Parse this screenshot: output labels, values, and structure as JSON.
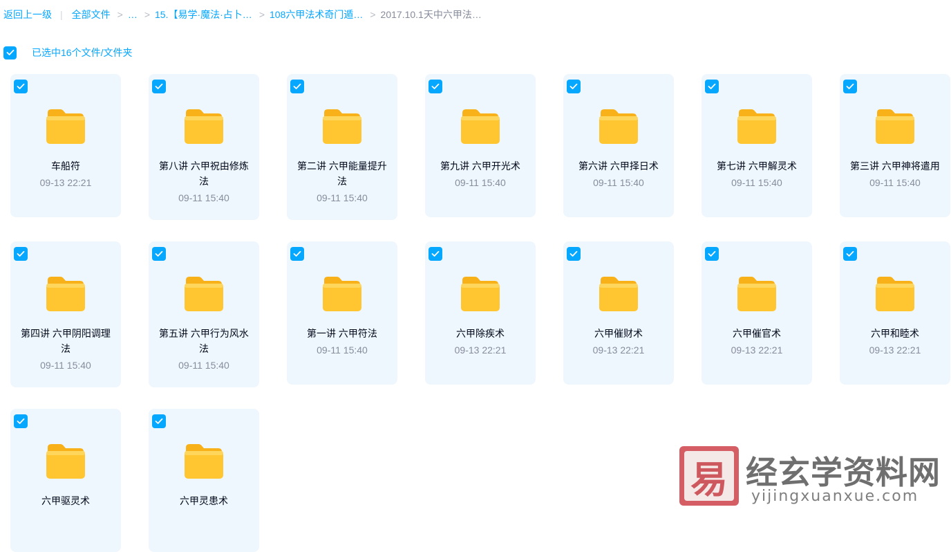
{
  "breadcrumb": {
    "back": "返回上一级",
    "all_files": "全部文件",
    "ellipsis": "…",
    "level1": "15.【易学·魔法·占卜…",
    "level2": "108六甲法术奇门遁…",
    "current": "2017.10.1天中六甲法…"
  },
  "selection": {
    "text": "已选中16个文件/文件夹",
    "checked": true
  },
  "colors": {
    "accent": "#06a7ff",
    "card_bg": "#eef7fe",
    "folder_yellow": "#ffc631",
    "folder_back": "#f9b11a"
  },
  "files": [
    {
      "name": "车船符",
      "time": "09-13 22:21",
      "icon": "folder-icon",
      "checked": true
    },
    {
      "name": "第八讲 六甲祝由修炼法",
      "time": "09-11 15:40",
      "icon": "folder-icon",
      "checked": true
    },
    {
      "name": "第二讲 六甲能量提升法",
      "time": "09-11 15:40",
      "icon": "folder-icon",
      "checked": true
    },
    {
      "name": "第九讲 六甲开光术",
      "time": "09-11 15:40",
      "icon": "folder-icon",
      "checked": true
    },
    {
      "name": "第六讲 六甲择日术",
      "time": "09-11 15:40",
      "icon": "folder-icon",
      "checked": true
    },
    {
      "name": "第七讲 六甲解灵术",
      "time": "09-11 15:40",
      "icon": "folder-icon",
      "checked": true
    },
    {
      "name": "第三讲 六甲神将遣用",
      "time": "09-11 15:40",
      "icon": "folder-icon",
      "checked": true
    },
    {
      "name": "第四讲 六甲阴阳调理法",
      "time": "09-11 15:40",
      "icon": "folder-icon",
      "checked": true
    },
    {
      "name": "第五讲 六甲行为风水法",
      "time": "09-11 15:40",
      "icon": "folder-icon",
      "checked": true
    },
    {
      "name": "第一讲 六甲符法",
      "time": "09-11 15:40",
      "icon": "folder-icon",
      "checked": true
    },
    {
      "name": "六甲除疾术",
      "time": "09-13 22:21",
      "icon": "folder-icon",
      "checked": true
    },
    {
      "name": "六甲催财术",
      "time": "09-13 22:21",
      "icon": "folder-icon",
      "checked": true
    },
    {
      "name": "六甲催官术",
      "time": "09-13 22:21",
      "icon": "folder-icon",
      "checked": true
    },
    {
      "name": "六甲和睦术",
      "time": "09-13 22:21",
      "icon": "folder-icon",
      "checked": true
    },
    {
      "name": "六甲驱灵术",
      "time": "",
      "icon": "folder-icon",
      "checked": true
    },
    {
      "name": "六甲灵患术",
      "time": "",
      "icon": "folder-icon",
      "checked": true
    }
  ],
  "watermark": {
    "seal_char": "易",
    "title": "经玄学资料网",
    "url": "yijingxuanxue.com"
  }
}
